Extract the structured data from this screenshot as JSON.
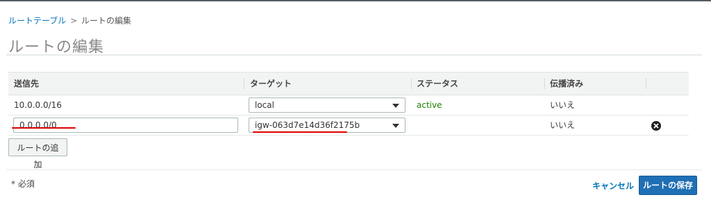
{
  "breadcrumb": {
    "parent": "ルートテーブル",
    "separator": ">",
    "current": "ルートの編集"
  },
  "page_title": "ルートの編集",
  "table": {
    "headers": [
      "送信先",
      "ターゲット",
      "ステータス",
      "伝播済み"
    ],
    "rows": [
      {
        "destination": "10.0.0.0/16",
        "target": "local",
        "status": "active",
        "propagated": "いいえ"
      },
      {
        "destination": "0.0.0.0/0",
        "target": "igw-063d7e14d36f2175b",
        "status": "",
        "propagated": "いいえ"
      }
    ]
  },
  "add_route_label": "ルートの追加",
  "required_note": "* 必須",
  "cancel_label": "キャンセル",
  "save_label": "ルートの保存",
  "colors": {
    "link": "#0073bb",
    "status_active": "#1d8102",
    "primary_button": "#1f6fb5",
    "annotation": "#e00000"
  },
  "icons": {
    "remove_row": "remove-circle-icon",
    "dropdown": "caret-down-icon"
  }
}
